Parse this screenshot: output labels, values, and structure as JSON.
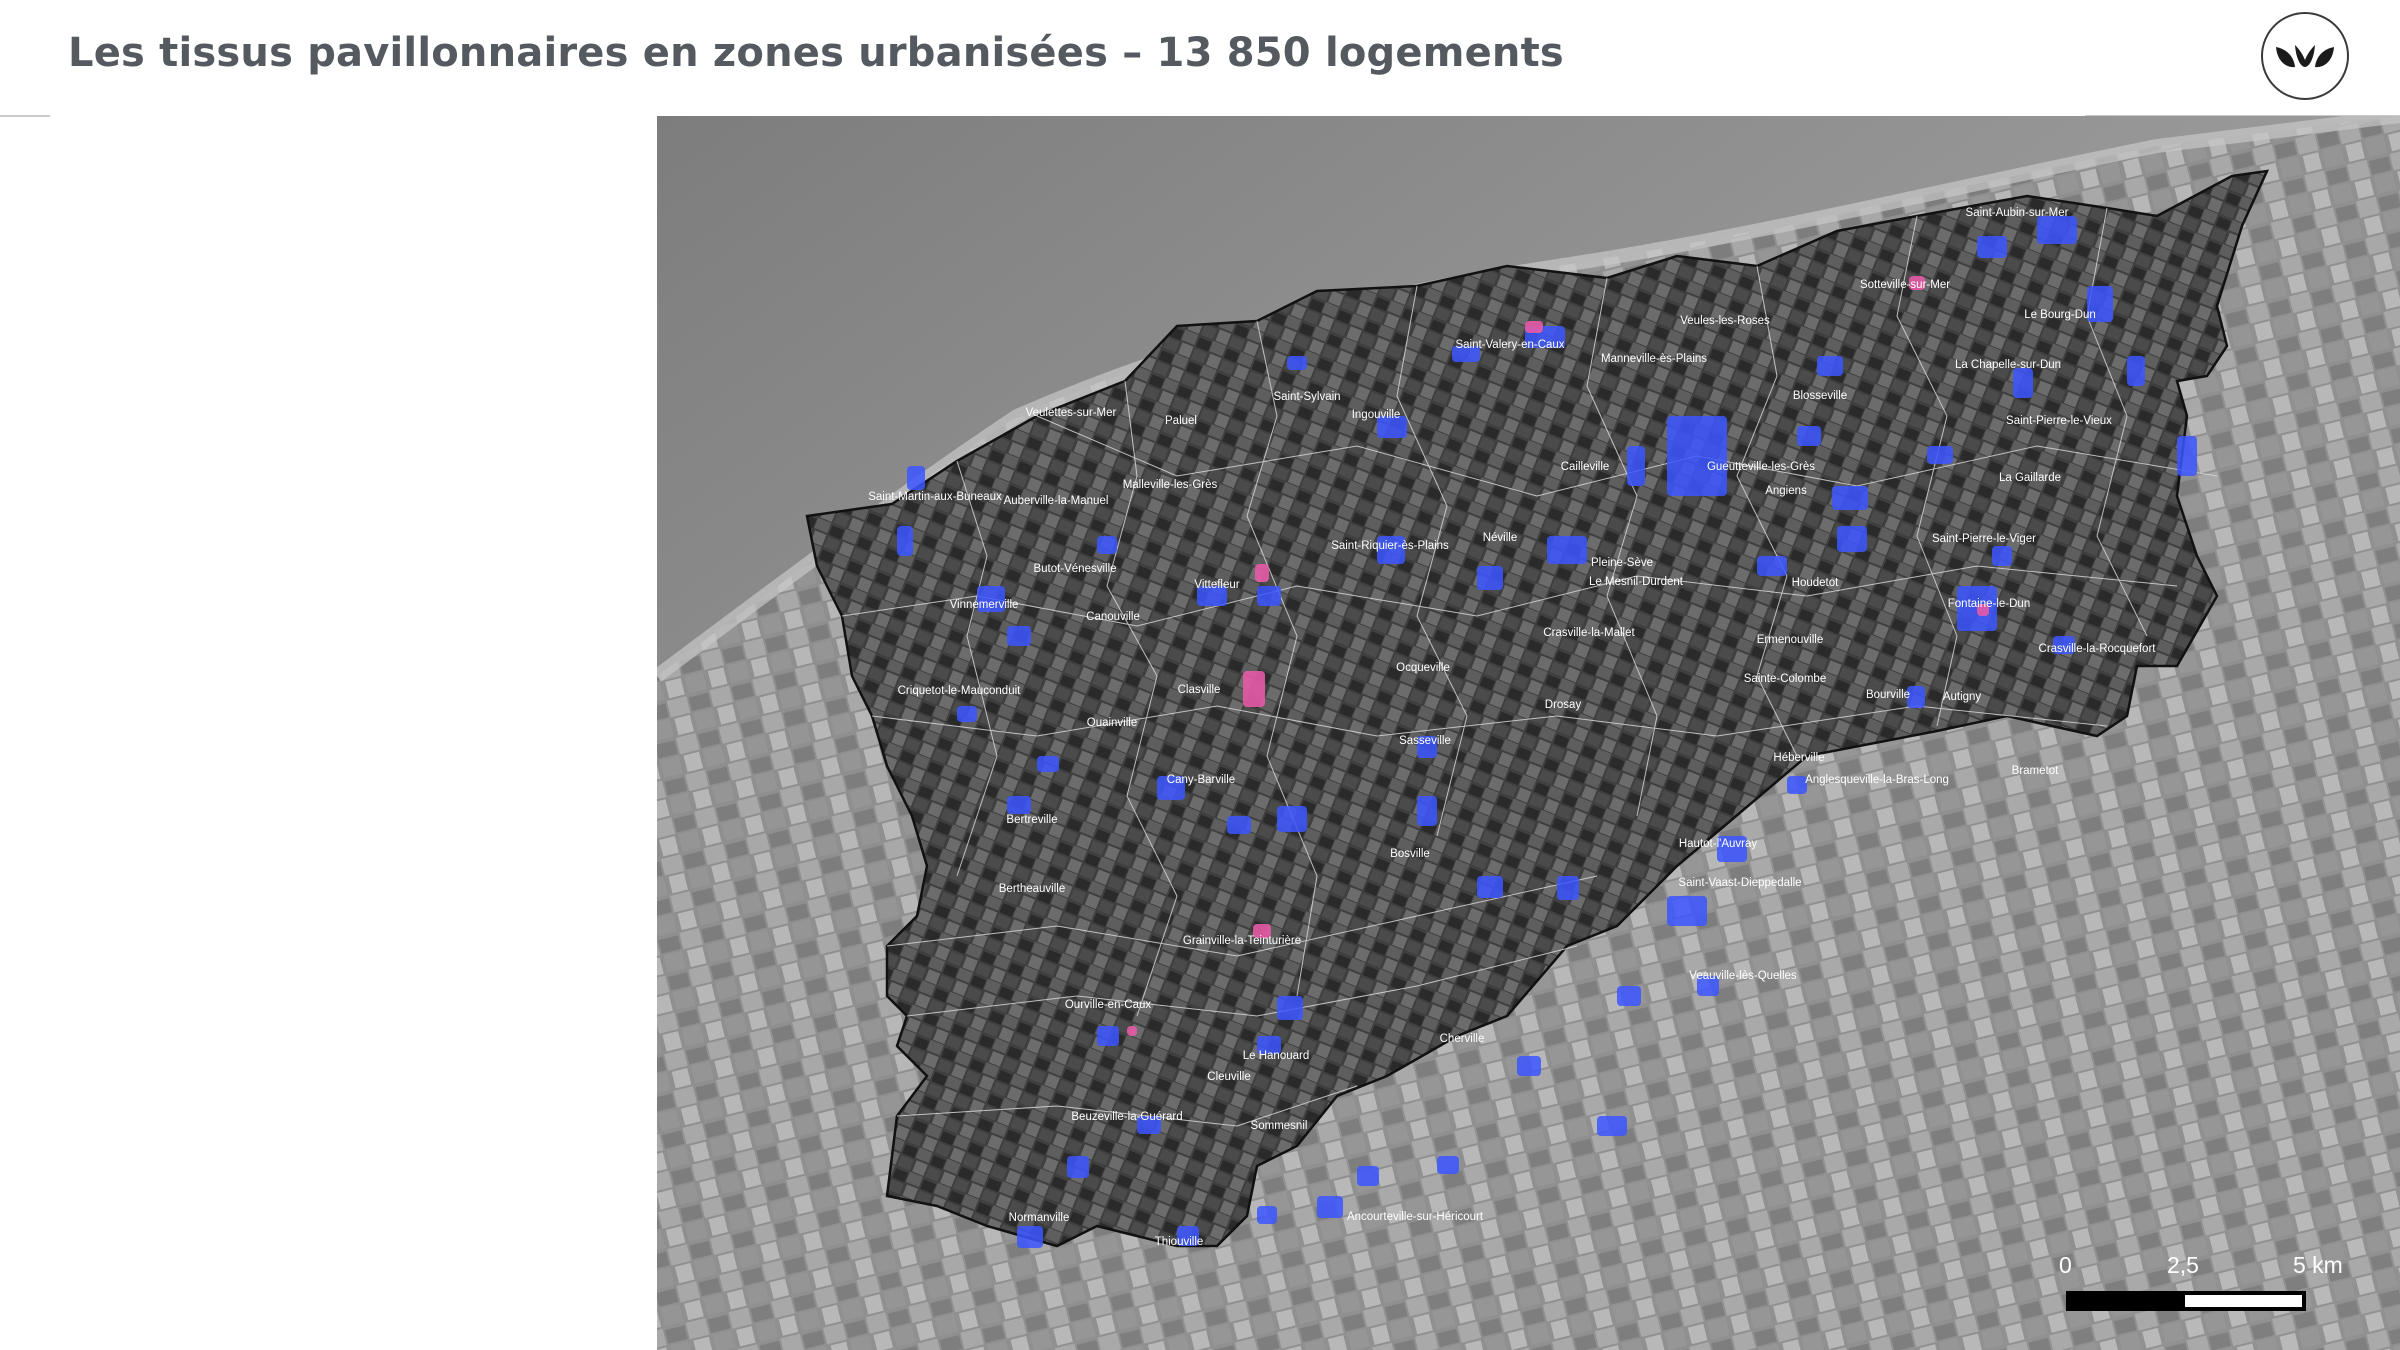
{
  "header": {
    "title": "Les tissus pavillonnaires en zones urbanisées – 13 850 logements",
    "logo_icon": "leaf-logo-icon"
  },
  "legend_colors": {
    "pavillonnaire": "#3c56ff",
    "centre": "#e55aa6"
  },
  "map": {
    "places": [
      "Saint-Aubin-sur-Mer",
      "Sotteville-sur-Mer",
      "Le Bourg-Dun",
      "Veules-les-Roses",
      "Saint-Valery-en-Caux",
      "Manneville-ès-Plains",
      "La Chapelle-sur-Dun",
      "Blosseville",
      "Saint-Pierre-le-Vieux",
      "Veulettes-sur-Mer",
      "Paluel",
      "Saint-Sylvain",
      "Ingouville",
      "Cailleville",
      "Gueutteville-les-Grès",
      "Angiens",
      "La Gaillarde",
      "Malleville-les-Grès",
      "Saint-Martin-aux-Buneaux",
      "Auberville-la-Manuel",
      "Saint-Riquier-ès-Plains",
      "Néville",
      "Saint-Pierre-le-Viger",
      "Butot-Vénesville",
      "Vittefleur",
      "Pleine-Sève",
      "Le Mesnil-Durdent",
      "Houdetot",
      "Vinnemerville",
      "Fontaine-le-Dun",
      "Canouville",
      "Crasville-la-Mallet",
      "Ermenouville",
      "Crasville-la-Rocquefort",
      "Ocqueville",
      "Sainte-Colombe",
      "Criquetot-le-Mauconduit",
      "Clasville",
      "Drosay",
      "Bourville",
      "Autigny",
      "Ouainville",
      "Sasseville",
      "Héberville",
      "Cany-Barville",
      "Anglesqueville-la-Bras-Long",
      "Brametot",
      "Bertreville",
      "Bosville",
      "Hautot-l'Auvray",
      "Saint-Vaast-Dieppedalle",
      "Bertheauville",
      "Grainville-la-Teinturière",
      "Veauville-lès-Quelles",
      "Ourville-en-Caux",
      "Cleuville",
      "Le Hanouard",
      "Beuzeville-la-Guérard",
      "Sommesnil",
      "Normanville",
      "Thiouville",
      "Ancourteville-sur-Héricourt",
      "Cherville"
    ],
    "scale_bar": {
      "labels": [
        "0",
        "2,5",
        "5 km"
      ]
    }
  }
}
